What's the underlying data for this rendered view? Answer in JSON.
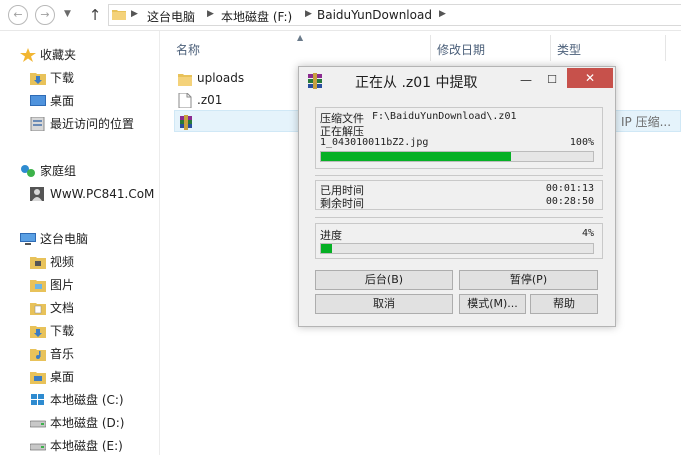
{
  "address_bar": {
    "crumbs": [
      "这台电脑",
      "本地磁盘 (F:)",
      "BaiduYunDownload"
    ]
  },
  "sidebar": {
    "favorites_title": "收藏夹",
    "favorites": [
      "下载",
      "桌面",
      "最近访问的位置"
    ],
    "homegroup_title": "家庭组",
    "homegroup_user": "WwW.PC841.CoM",
    "thispc_title": "这台电脑",
    "thispc_items": [
      "视频",
      "图片",
      "文档",
      "下载",
      "音乐",
      "桌面",
      "本地磁盘 (C:)",
      "本地磁盘 (D:)",
      "本地磁盘 (E:)"
    ]
  },
  "file_list": {
    "columns": [
      "名称",
      "修改日期",
      "类型"
    ],
    "files": [
      {
        "name": "uploads",
        "type": ""
      },
      {
        "name": ".z01",
        "type": ""
      },
      {
        "name": "",
        "type": "IP 压缩..."
      }
    ]
  },
  "dialog": {
    "title": "正在从 .z01 中提取",
    "close_symbol": "✕",
    "archive_label": "压缩文件",
    "archive_path": "F:\\BaiduYunDownload\\.z01",
    "extracting_label": "正在解压",
    "current_file": "1_043010011bZ2.jpg",
    "file_percent": "100%",
    "file_progress": 0.7,
    "elapsed_label": "已用时间",
    "elapsed_value": "00:01:13",
    "remaining_label": "剩余时间",
    "remaining_value": "00:28:50",
    "progress_label": "进度",
    "progress_percent": "4%",
    "total_progress": 0.04,
    "buttons": {
      "background": "后台(B)",
      "pause": "暂停(P)",
      "cancel": "取消",
      "mode": "模式(M)...",
      "help": "帮助"
    }
  },
  "colors": {
    "progress_green": "#06b025",
    "close_red": "#c7514b",
    "selection_blue": "#e5f3fb"
  }
}
